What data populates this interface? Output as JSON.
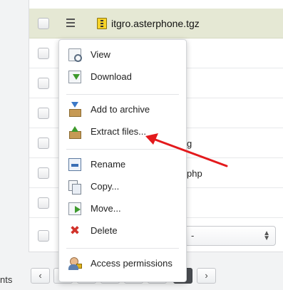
{
  "file_table": {
    "selected_file": "itgro.asterphone.tgz",
    "partial_texts": [
      "g",
      "php"
    ],
    "select_value": "-"
  },
  "bottom": {
    "left_text": "nts",
    "prev_label": "‹",
    "next_label": "›"
  },
  "context_menu": {
    "items": [
      {
        "label": "View",
        "icon": "view-icon"
      },
      {
        "label": "Download",
        "icon": "download-icon"
      },
      {
        "label": "Add to archive",
        "icon": "add-to-archive-icon"
      },
      {
        "label": "Extract files...",
        "icon": "extract-files-icon"
      },
      {
        "label": "Rename",
        "icon": "rename-icon"
      },
      {
        "label": "Copy...",
        "icon": "copy-icon"
      },
      {
        "label": "Move...",
        "icon": "move-icon"
      },
      {
        "label": "Delete",
        "icon": "delete-icon"
      },
      {
        "label": "Access permissions",
        "icon": "access-permissions-icon"
      }
    ]
  },
  "colors": {
    "selected_row": "#e5e8d4",
    "annotation_arrow": "#e3191c",
    "delete_icon": "#d1322a"
  }
}
